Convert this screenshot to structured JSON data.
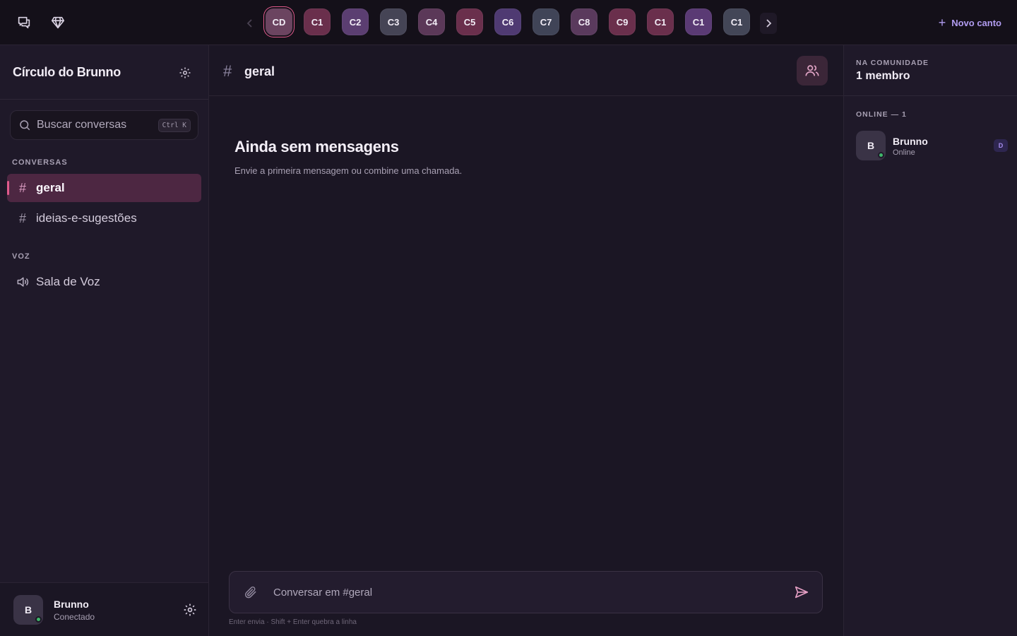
{
  "topbar": {
    "chat_icon": "chat-bubbles-icon",
    "gem_icon": "gem-icon",
    "new_button_label": "Novo canto",
    "workspaces": [
      {
        "label": "CD",
        "color": "#6b4460",
        "active": true
      },
      {
        "label": "C1",
        "color": "#6a2f4c"
      },
      {
        "label": "C2",
        "color": "#5b3e71"
      },
      {
        "label": "C3",
        "color": "#454455"
      },
      {
        "label": "C4",
        "color": "#5b3858"
      },
      {
        "label": "C5",
        "color": "#6a2f4c"
      },
      {
        "label": "C6",
        "color": "#4f3a72"
      },
      {
        "label": "C7",
        "color": "#404457"
      },
      {
        "label": "C8",
        "color": "#5a3a5d"
      },
      {
        "label": "C9",
        "color": "#6a2f4c"
      },
      {
        "label": "C1",
        "color": "#6a2f4c"
      },
      {
        "label": "C1",
        "color": "#5a3a74"
      },
      {
        "label": "C1",
        "color": "#434657"
      }
    ]
  },
  "sidebar": {
    "server_name": "Círculo do Brunno",
    "search": {
      "placeholder": "Buscar conversas",
      "shortcut": "Ctrl K"
    },
    "sections": {
      "text": "CONVERSAS",
      "voice": "VOZ"
    },
    "channels": [
      {
        "name": "geral",
        "active": true
      },
      {
        "name": "ideias-e-sugestões",
        "active": false
      }
    ],
    "voice_channels": [
      {
        "name": "Sala de Voz"
      }
    ],
    "user": {
      "initial": "B",
      "name": "Brunno",
      "status": "Conectado"
    }
  },
  "chat": {
    "channel_name": "geral",
    "empty_title": "Ainda sem mensagens",
    "empty_subtitle": "Envie a primeira mensagem ou combine uma chamada.",
    "composer_placeholder": "Conversar em #geral",
    "hint": "Enter envia · Shift + Enter quebra a linha"
  },
  "members_panel": {
    "label": "NA COMUNIDADE",
    "count": "1 membro",
    "online_label": "ONLINE — 1",
    "members": [
      {
        "initial": "B",
        "name": "Brunno",
        "status": "Online",
        "role": "D"
      }
    ]
  },
  "colors": {
    "accent": "#e05a8c",
    "link": "#b19cf0",
    "online": "#3fb66b"
  }
}
